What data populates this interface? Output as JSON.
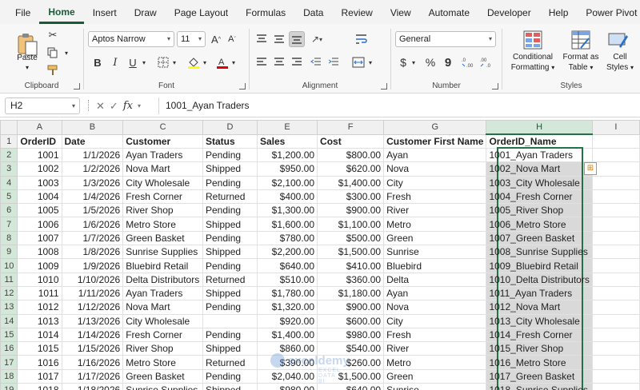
{
  "menu": [
    "File",
    "Home",
    "Insert",
    "Draw",
    "Page Layout",
    "Formulas",
    "Data",
    "Review",
    "View",
    "Automate",
    "Developer",
    "Help",
    "Power Pivot"
  ],
  "menu_active": "Home",
  "ribbon": {
    "clipboard": {
      "label": "Clipboard",
      "paste": "Paste"
    },
    "font": {
      "label": "Font",
      "name": "Aptos Narrow",
      "size": "11",
      "bold": "B",
      "italic": "I",
      "underline": "U"
    },
    "alignment": {
      "label": "Alignment"
    },
    "number": {
      "label": "Number",
      "format": "General",
      "currency": "$",
      "percent": "%",
      "comma": "9"
    },
    "styles": {
      "label": "Styles",
      "conditional": "Conditional",
      "conditional2": "Formatting",
      "format_as": "Format as",
      "format_as2": "Table",
      "cell": "Cell",
      "cell2": "Styles"
    }
  },
  "formula_bar": {
    "name_box": "H2",
    "fx": "fx",
    "content": "1001_Ayan Traders"
  },
  "columns": [
    "A",
    "B",
    "C",
    "D",
    "E",
    "F",
    "G",
    "H",
    "I"
  ],
  "selected_column": "H",
  "rows": [
    {
      "n": "1",
      "a": "OrderID",
      "b": "Date",
      "c": "Customer",
      "d": "Status",
      "e": "Sales",
      "f": "Cost",
      "g": "Customer First Name",
      "h": "OrderID_Name"
    },
    {
      "n": "2",
      "a": "1001",
      "b": "1/1/2026",
      "c": "Ayan Traders",
      "d": "Pending",
      "e": "$1,200.00",
      "f": "$800.00",
      "g": "Ayan",
      "h": "1001_Ayan Traders"
    },
    {
      "n": "3",
      "a": "1002",
      "b": "1/2/2026",
      "c": "Nova Mart",
      "d": "Shipped",
      "e": "$950.00",
      "f": "$620.00",
      "g": "Nova",
      "h": "1002_Nova Mart"
    },
    {
      "n": "4",
      "a": "1003",
      "b": "1/3/2026",
      "c": "City Wholesale",
      "d": "Pending",
      "e": "$2,100.00",
      "f": "$1,400.00",
      "g": "City",
      "h": "1003_City Wholesale"
    },
    {
      "n": "5",
      "a": "1004",
      "b": "1/4/2026",
      "c": "Fresh Corner",
      "d": "Returned",
      "e": "$400.00",
      "f": "$300.00",
      "g": "Fresh",
      "h": "1004_Fresh Corner"
    },
    {
      "n": "6",
      "a": "1005",
      "b": "1/5/2026",
      "c": "River Shop",
      "d": "Pending",
      "e": "$1,300.00",
      "f": "$900.00",
      "g": "River",
      "h": "1005_River Shop"
    },
    {
      "n": "7",
      "a": "1006",
      "b": "1/6/2026",
      "c": "Metro Store",
      "d": "Shipped",
      "e": "$1,600.00",
      "f": "$1,100.00",
      "g": "Metro",
      "h": "1006_Metro Store"
    },
    {
      "n": "8",
      "a": "1007",
      "b": "1/7/2026",
      "c": "Green Basket",
      "d": "Pending",
      "e": "$780.00",
      "f": "$500.00",
      "g": "Green",
      "h": "1007_Green Basket"
    },
    {
      "n": "9",
      "a": "1008",
      "b": "1/8/2026",
      "c": "Sunrise Supplies",
      "d": "Shipped",
      "e": "$2,200.00",
      "f": "$1,500.00",
      "g": "Sunrise",
      "h": "1008_Sunrise Supplies"
    },
    {
      "n": "10",
      "a": "1009",
      "b": "1/9/2026",
      "c": "Bluebird Retail",
      "d": "Pending",
      "e": "$640.00",
      "f": "$410.00",
      "g": "Bluebird",
      "h": "1009_Bluebird Retail"
    },
    {
      "n": "11",
      "a": "1010",
      "b": "1/10/2026",
      "c": "Delta Distributors",
      "d": "Returned",
      "e": "$510.00",
      "f": "$360.00",
      "g": "Delta",
      "h": "1010_Delta Distributors"
    },
    {
      "n": "12",
      "a": "1011",
      "b": "1/11/2026",
      "c": "Ayan Traders",
      "d": "Shipped",
      "e": "$1,780.00",
      "f": "$1,180.00",
      "g": "Ayan",
      "h": "1011_Ayan Traders"
    },
    {
      "n": "13",
      "a": "1012",
      "b": "1/12/2026",
      "c": "Nova Mart",
      "d": "Pending",
      "e": "$1,320.00",
      "f": "$900.00",
      "g": "Nova",
      "h": "1012_Nova Mart"
    },
    {
      "n": "14",
      "a": "1013",
      "b": "1/13/2026",
      "c": "City Wholesale",
      "d": "",
      "e": "$920.00",
      "f": "$600.00",
      "g": "City",
      "h": "1013_City Wholesale"
    },
    {
      "n": "15",
      "a": "1014",
      "b": "1/14/2026",
      "c": "Fresh Corner",
      "d": "Pending",
      "e": "$1,400.00",
      "f": "$980.00",
      "g": "Fresh",
      "h": "1014_Fresh Corner"
    },
    {
      "n": "16",
      "a": "1015",
      "b": "1/15/2026",
      "c": "River Shop",
      "d": "Shipped",
      "e": "$860.00",
      "f": "$540.00",
      "g": "River",
      "h": "1015_River Shop"
    },
    {
      "n": "17",
      "a": "1016",
      "b": "1/16/2026",
      "c": "Metro Store",
      "d": "Returned",
      "e": "$390.00",
      "f": "$260.00",
      "g": "Metro",
      "h": "1016_Metro Store"
    },
    {
      "n": "18",
      "a": "1017",
      "b": "1/17/2026",
      "c": "Green Basket",
      "d": "Pending",
      "e": "$2,040.00",
      "f": "$1,500.00",
      "g": "Green",
      "h": "1017_Green Basket"
    },
    {
      "n": "19",
      "a": "1018",
      "b": "1/18/2026",
      "c": "Sunrise Supplies",
      "d": "Shipped",
      "e": "$980.00",
      "f": "$640.00",
      "g": "Sunrise",
      "h": "1018_Sunrise Supplies"
    }
  ],
  "watermark": {
    "name": "exceldemy",
    "sub": "EXCEL · DATA · BI"
  },
  "colors": {
    "accent": "#217346",
    "selected_fill": "#d9d9d9"
  }
}
